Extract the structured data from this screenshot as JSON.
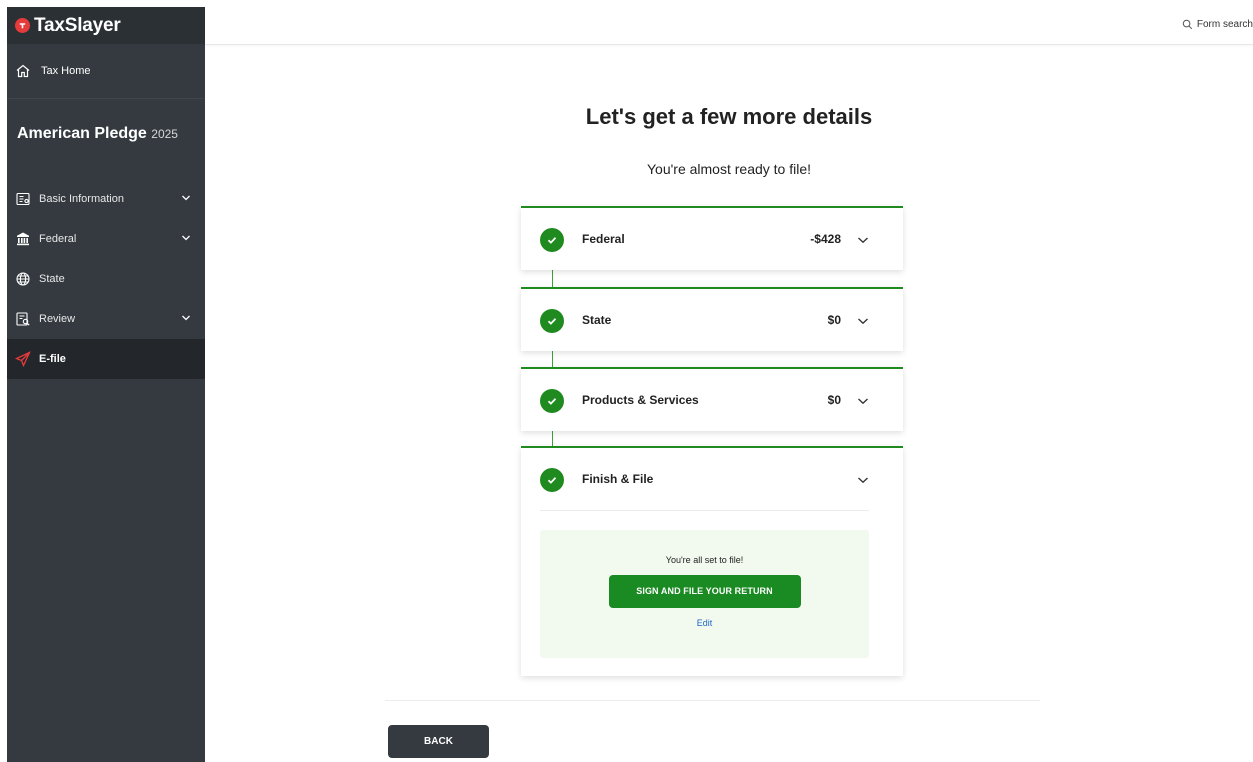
{
  "brand": {
    "name": "TaxSlayer"
  },
  "sidebar": {
    "home_label": "Tax Home",
    "product_name": "American Pledge",
    "product_year": "2025",
    "items": [
      {
        "label": "Basic Information",
        "icon": "id-card-icon",
        "has_chevron": true
      },
      {
        "label": "Federal",
        "icon": "government-building-icon",
        "has_chevron": true
      },
      {
        "label": "State",
        "icon": "globe-icon",
        "has_chevron": false
      },
      {
        "label": "Review",
        "icon": "document-search-icon",
        "has_chevron": true
      },
      {
        "label": "E-file",
        "icon": "paper-plane-icon",
        "has_chevron": false,
        "active": true
      }
    ]
  },
  "topbar": {
    "form_search_label": "Form search"
  },
  "main": {
    "title": "Let's get a few more details",
    "subtitle": "You're almost ready to file!",
    "sections": [
      {
        "label": "Federal",
        "amount": "-$428",
        "complete": true
      },
      {
        "label": "State",
        "amount": "$0",
        "complete": true
      },
      {
        "label": "Products & Services",
        "amount": "$0",
        "complete": true
      },
      {
        "label": "Finish & File",
        "amount": "",
        "complete": true
      }
    ],
    "finish": {
      "ready_text": "You're all set to file!",
      "sign_button": "SIGN AND FILE YOUR RETURN",
      "edit_link": "Edit"
    },
    "back_button": "BACK"
  },
  "colors": {
    "accent_green": "#1f8a1f",
    "sidebar_bg": "#343a40",
    "brand_red": "#e63b3b",
    "link_blue": "#1e66c5"
  }
}
